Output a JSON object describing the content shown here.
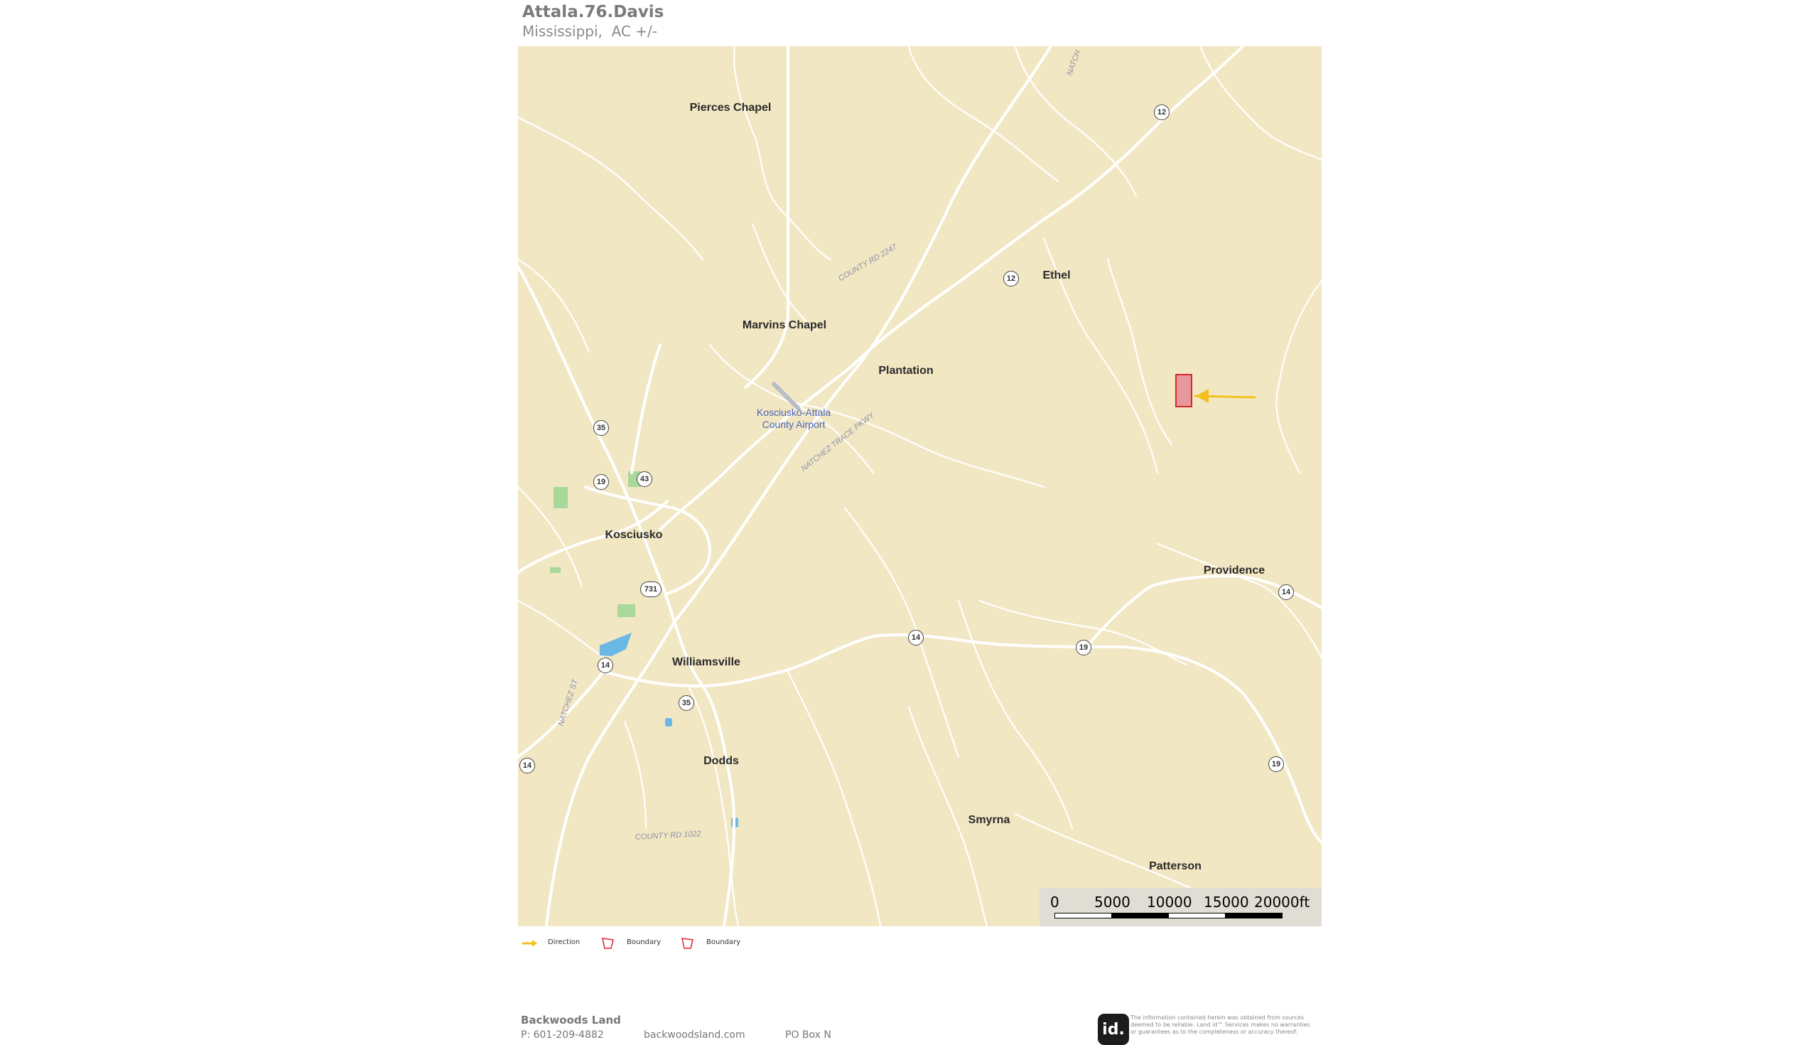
{
  "header": {
    "title": "Attala.76.Davis",
    "subtitle": "Mississippi,  AC +/-"
  },
  "map": {
    "places": [
      {
        "name": "Pierces Chapel"
      },
      {
        "name": "Ethel"
      },
      {
        "name": "Marvins Chapel"
      },
      {
        "name": "Plantation"
      },
      {
        "name": "Kosciusko"
      },
      {
        "name": "Providence"
      },
      {
        "name": "Williamsville"
      },
      {
        "name": "Dodds"
      },
      {
        "name": "Smyrna"
      },
      {
        "name": "Patterson"
      }
    ],
    "airport": {
      "line1": "Kosciusko-Attala",
      "line2": "County Airport"
    },
    "road_labels": [
      {
        "text": "NATCHEZ TRACE PKWY"
      },
      {
        "text": "COUNTY RD 2247"
      },
      {
        "text": "NATCHEZ ST"
      },
      {
        "text": "COUNTY RD 1022"
      },
      {
        "text": "NATCH"
      }
    ],
    "shields": [
      "12",
      "12",
      "35",
      "43",
      "19",
      "731",
      "14",
      "14",
      "35",
      "14",
      "19",
      "14",
      "19",
      "14"
    ],
    "colors": {
      "background": "#f2e7c3",
      "roads": "#ffffff",
      "water": "#6bb7e6",
      "parks": "#a8d89a",
      "boundary": "#d9262c",
      "arrow": "#f4c020"
    }
  },
  "scale": {
    "labels": [
      "0",
      "5000",
      "10000",
      "15000",
      "20000ft"
    ]
  },
  "legend": [
    {
      "icon": "direction-arrow-icon",
      "label": "Direction"
    },
    {
      "icon": "boundary-icon",
      "label": "Boundary"
    },
    {
      "icon": "boundary-icon",
      "label": "Boundary"
    }
  ],
  "footer": {
    "company": "Backwoods Land",
    "phone": "P: 601-209-4882",
    "website": "backwoodsland.com",
    "address": "PO Box N",
    "logo_text": "id.",
    "disclaimer": "The information contained herein was obtained from sources deemed to be reliable. Land id™ Services makes no warranties or guarantees as to the completeness or accuracy thereof."
  }
}
